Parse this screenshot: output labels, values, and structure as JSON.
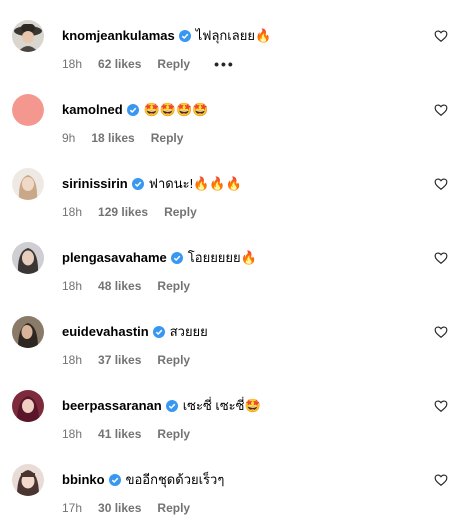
{
  "colors": {
    "verified": "#3897f0",
    "secondary_text": "#737373",
    "text": "#000000"
  },
  "comments": [
    {
      "username": "knomjeankulamas",
      "verified": true,
      "text": "ไฟลุกเลยย🔥",
      "time": "18h",
      "likes": "62 likes",
      "reply": "Reply",
      "more": "•••",
      "avatar_icon": "avatar-photo-hat"
    },
    {
      "username": "kamolned",
      "verified": true,
      "text": "🤩🤩🤩🤩",
      "time": "9h",
      "likes": "18 likes",
      "reply": "Reply",
      "avatar_icon": "avatar-pink-circle"
    },
    {
      "username": "sirinissirin",
      "verified": true,
      "text": "ฟาดนะ!🔥🔥🔥",
      "time": "18h",
      "likes": "129 likes",
      "reply": "Reply",
      "avatar_icon": "avatar-photo-woman"
    },
    {
      "username": "plengasavahame",
      "verified": true,
      "text": "โอยยยยย🔥",
      "time": "18h",
      "likes": "48 likes",
      "reply": "Reply",
      "avatar_icon": "avatar-photo-woman"
    },
    {
      "username": "euidevahastin",
      "verified": true,
      "text": "สวยยย",
      "time": "18h",
      "likes": "37 likes",
      "reply": "Reply",
      "avatar_icon": "avatar-photo-woman"
    },
    {
      "username": "beerpassaranan",
      "verified": true,
      "text": "เซะซี่ เซะซี่🤩",
      "time": "18h",
      "likes": "41 likes",
      "reply": "Reply",
      "avatar_icon": "avatar-photo-woman"
    },
    {
      "username": "bbinko",
      "verified": true,
      "text": "ขออีกชุดด้วยเร็วๆ",
      "time": "17h",
      "likes": "30 likes",
      "reply": "Reply",
      "avatar_icon": "avatar-photo-woman"
    }
  ]
}
